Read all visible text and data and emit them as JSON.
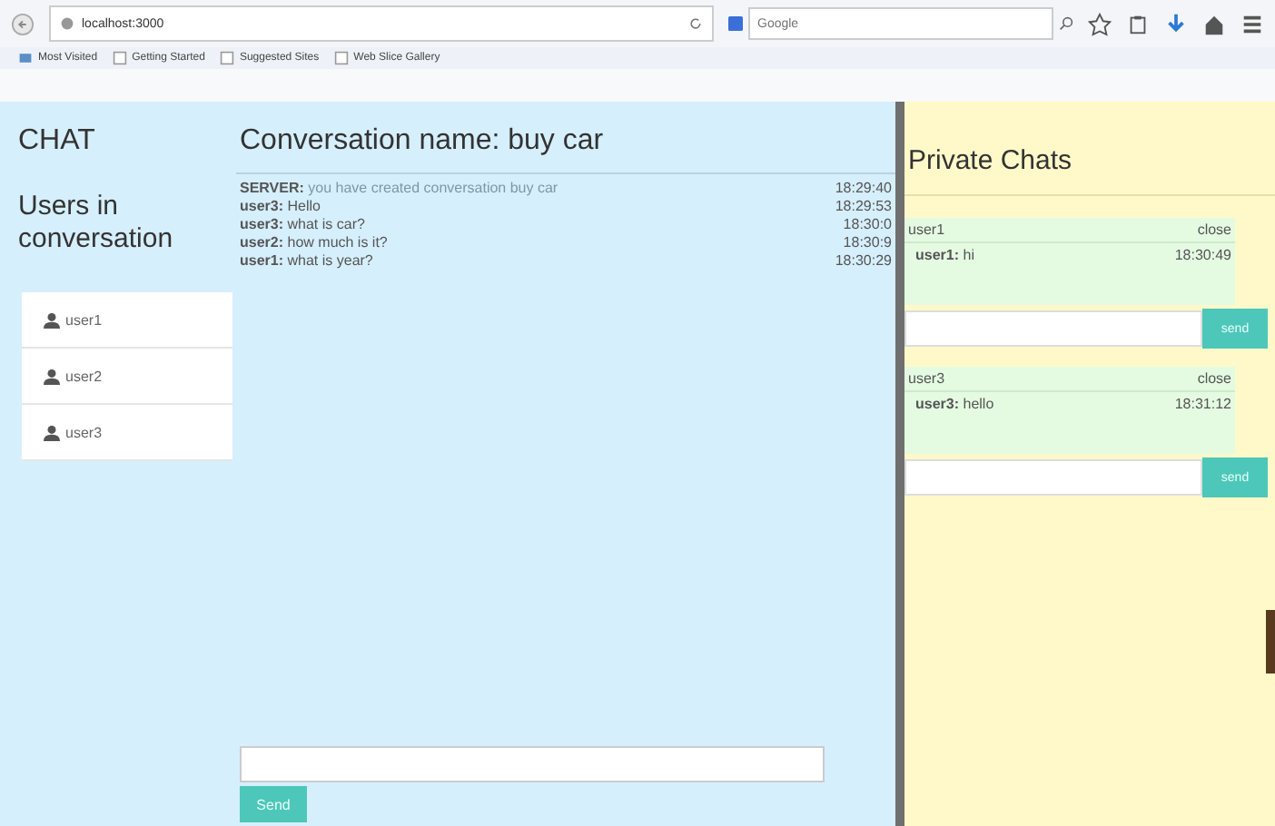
{
  "browser": {
    "url": "localhost:3000",
    "search_placeholder": "Google",
    "bookmarks": [
      "Most Visited",
      "Getting Started",
      "Suggested Sites",
      "Web Slice Gallery"
    ]
  },
  "sidebar": {
    "title": "CHAT",
    "users_heading": "Users in conversation",
    "users": [
      "user1",
      "user2",
      "user3"
    ]
  },
  "conversation": {
    "title": "Conversation name: buy car",
    "messages": [
      {
        "kind": "server",
        "sender": "SERVER:",
        "text": "you have created conversation buy car",
        "time": "18:29:40"
      },
      {
        "kind": "user",
        "sender": "user3:",
        "text": "Hello",
        "time": "18:29:53"
      },
      {
        "kind": "user",
        "sender": "user3:",
        "text": "what is car?",
        "time": "18:30:0"
      },
      {
        "kind": "user",
        "sender": "user2:",
        "text": "how much is it?",
        "time": "18:30:9"
      },
      {
        "kind": "user",
        "sender": "user1:",
        "text": "what is year?",
        "time": "18:30:29"
      }
    ],
    "send_button": "Send"
  },
  "private_chats": {
    "title": "Private Chats",
    "chats": [
      {
        "user": "user1",
        "close": "close",
        "messages": [
          {
            "sender": "user1:",
            "text": "hi",
            "time": "18:30:49"
          }
        ],
        "send_button": "send"
      },
      {
        "user": "user3",
        "close": "close",
        "messages": [
          {
            "sender": "user3:",
            "text": "hello",
            "time": "18:31:12"
          }
        ],
        "send_button": "send"
      }
    ]
  }
}
